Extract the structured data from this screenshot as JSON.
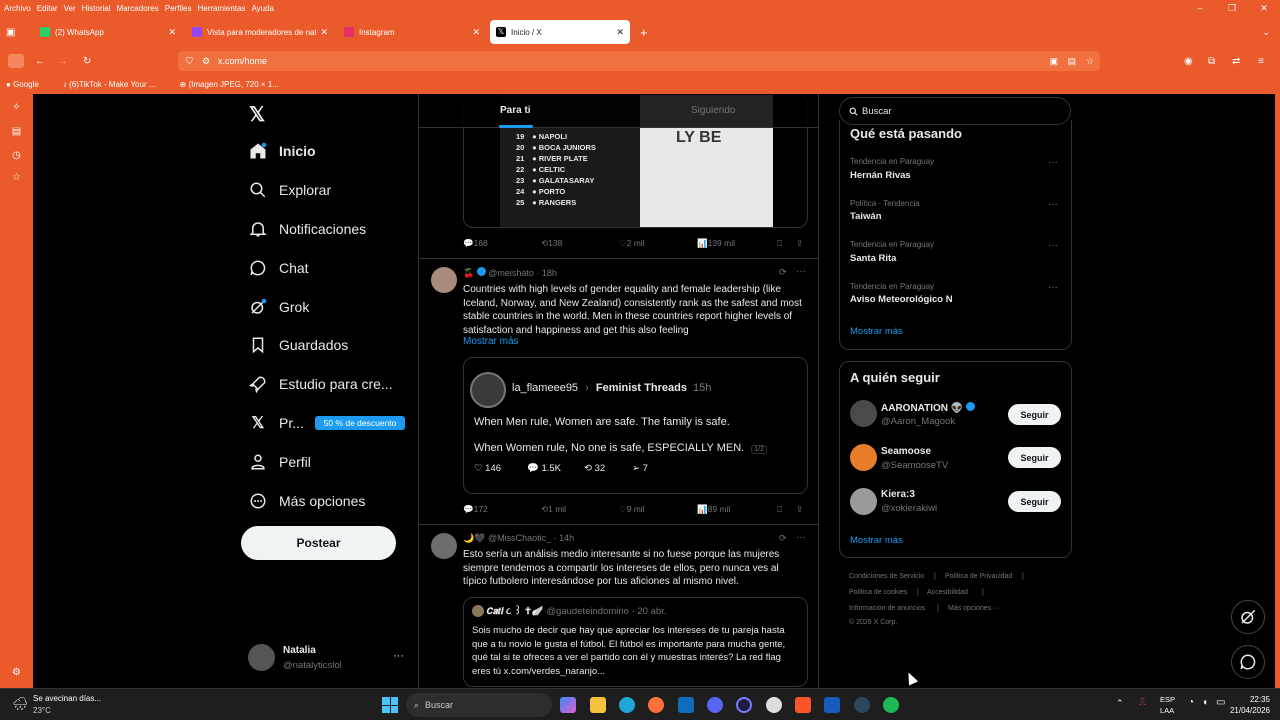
{
  "browser": {
    "menu": [
      "Archivo",
      "Editar",
      "Ver",
      "Historial",
      "Marcadores",
      "Perfiles",
      "Herramientas",
      "Ayuda"
    ],
    "tabs": [
      {
        "label": "(2) WhatsApp",
        "fav_color": "#25d366"
      },
      {
        "label": "Vista para moderadores de nat",
        "fav_color": "#9146ff"
      },
      {
        "label": "Instagram",
        "fav_color": "#e1306c"
      },
      {
        "label": "Inicio / X",
        "fav_color": "#000000"
      }
    ],
    "url": "x.com/home",
    "bookmarks": [
      "Google",
      "(6)TikTok - Make Your ...",
      "(Imagen JPEG, 720 × 1..."
    ],
    "accent": "#ea5a2a"
  },
  "sidebar": {
    "items": [
      {
        "label": "Inicio"
      },
      {
        "label": "Explorar"
      },
      {
        "label": "Notificaciones"
      },
      {
        "label": "Chat"
      },
      {
        "label": "Grok"
      },
      {
        "label": "Guardados"
      },
      {
        "label": "Estudio para cre..."
      },
      {
        "label": "Pr..."
      },
      {
        "label": "Perfil"
      },
      {
        "label": "Más opciones"
      }
    ],
    "premium_badge": "50 % de descuento",
    "post_label": "Postear",
    "user": {
      "name": "Natalia",
      "handle": "@natalyticslol",
      "more": "···"
    }
  },
  "feed": {
    "tabs": [
      "Para ti",
      "Siguiendo"
    ],
    "ranking": [
      {
        "n": "19",
        "team": "NAPOLI"
      },
      {
        "n": "20",
        "team": "BOCA JUNIORS"
      },
      {
        "n": "21",
        "team": "RIVER PLATE"
      },
      {
        "n": "22",
        "team": "CELTIC"
      },
      {
        "n": "23",
        "team": "GALATASARAY"
      },
      {
        "n": "24",
        "team": "PORTO"
      },
      {
        "n": "25",
        "team": "RANGERS"
      }
    ],
    "image_overlay": "LY BE",
    "tweet1_actions": {
      "replies": "168",
      "retweets": "138",
      "likes": "2 mil",
      "views": "139 mil"
    },
    "tweet2": {
      "emoji": "🍒",
      "handle": "@meishato",
      "time": "· 18h",
      "text": "Countries with high levels of gender equality and female leadership (like Iceland, Norway, and New Zealand) consistently rank as the safest and most stable countries in the world. Men in these countries report higher levels of satisfaction and happiness and get this also feeling",
      "more": "Mostrar más",
      "quote": {
        "user": "la_flameee95",
        "community": "Feminist Threads",
        "time": "15h",
        "line1": "When Men rule, Women are safe. The family is safe.",
        "line2": "When Women rule, No one is safe, ESPECIALLY MEN.",
        "thread": "1/2",
        "likes": "146",
        "replies": "1.5K",
        "retweets": "32",
        "shares": "7"
      },
      "actions": {
        "replies": "172",
        "retweets": "1 mil",
        "likes": "9 mil",
        "views": "89 mil"
      }
    },
    "tweet3": {
      "emoji": "🌙🖤",
      "handle": "@MissChaotic_",
      "time": "· 14h",
      "text": "Esto sería un análisis medio interesante si no fuese porque las mujeres siempre tendemos a compartir los intereses de ellos, pero nunca ves al típico futbolero interesándose por tus aficiones al mismo nivel.",
      "quote": {
        "name": "𝘾𝙖𝙩𝙞 ૮ ꒱ ✝︎🪽",
        "handle": "@gaudeteindomino",
        "time": "· 20 abr.",
        "text": "Sois mucho de decir que hay que apreciar los intereses de tu pareja hasta que a tu novio le gusta el fútbol. El fútbol es importante para mucha gente, qué tal si te ofreces a ver el partido con él y muestras interés? La red flag eres tú x.com/verdes_naranjo..."
      }
    }
  },
  "right": {
    "search_placeholder": "Buscar",
    "trends_title": "Qué está pasando",
    "trends": [
      {
        "sub": "Tendencia en Paraguay",
        "title": "Hernán Rivas"
      },
      {
        "sub": "Política · Tendencia",
        "title": "Taiwán"
      },
      {
        "sub": "Tendencia en Paraguay",
        "title": "Santa Rita"
      },
      {
        "sub": "Tendencia en Paraguay",
        "title": "Aviso Meteorológico N"
      }
    ],
    "show_more": "Mostrar más",
    "follow_title": "A quién seguir",
    "follow": [
      {
        "name": "AARONATION 👽",
        "handle": "@Aaron_Magook",
        "btn": "Seguir"
      },
      {
        "name": "Seamoose",
        "handle": "@SeamooseTV",
        "btn": "Seguir"
      },
      {
        "name": "Kiera:3",
        "handle": "@xokierakiwi",
        "btn": "Seguir"
      }
    ],
    "footer": [
      "Condiciones de Servicio",
      "|",
      "Política de Privacidad",
      "|",
      "Política de cookies",
      "|",
      "Accesibilidad",
      "|",
      "Información de anuncios",
      "|",
      "Más opciones ···",
      "© 2026 X Corp."
    ]
  },
  "taskbar": {
    "weather": "Se avecinan días...",
    "temp": "23°C",
    "search": "Buscar",
    "lang1": "ESP",
    "lang2": "LAA",
    "time": "22:35",
    "date": "21/04/2026"
  }
}
